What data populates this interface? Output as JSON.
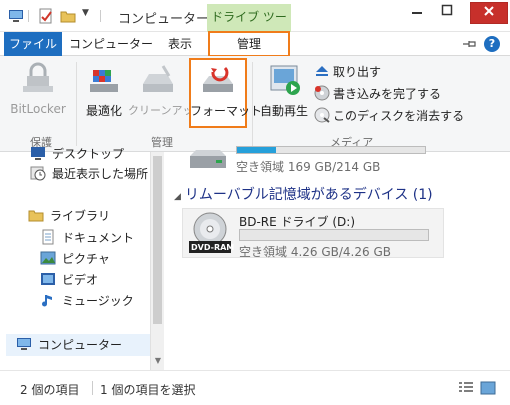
{
  "titlebar": {
    "title": "コンピューター",
    "context_tab": "ドライブ ツール"
  },
  "tabs": {
    "file": "ファイル",
    "computer": "コンピューター",
    "view": "表示",
    "manage": "管理"
  },
  "ribbon": {
    "bitlocker": "BitLocker",
    "optimize": "最適化",
    "cleanup": "クリーンアップ",
    "format": "フォーマット",
    "autoplay": "自動再生",
    "eject": "取り出す",
    "finish_burning": "書き込みを完了する",
    "erase_disc": "このディスクを消去する",
    "group_protect": "保護",
    "group_manage": "管理",
    "group_media": "メディア"
  },
  "nav": {
    "desktop": "デスクトップ",
    "recent": "最近表示した場所",
    "library": "ライブラリ",
    "documents": "ドキュメント",
    "pictures": "ピクチャ",
    "videos": "ビデオ",
    "music": "ミュージック",
    "computer": "コンピューター"
  },
  "content": {
    "hdd_free": "空き領域 169 GB/214 GB",
    "hdd_fill": 0.21,
    "removable_header": "リムーバブル記憶域があるデバイス (1)",
    "dvd_name": "BD-RE ドライブ (D:)",
    "dvd_free": "空き領域 4.26 GB/4.26 GB",
    "dvd_label": "DVD-RAM",
    "dvd_fill": 0.0
  },
  "status": {
    "items": "2 個の項目",
    "selected": "1 個の項目を選択"
  },
  "colors": {
    "accent": "#1e6ec0",
    "highlight": "#f07c1a",
    "context_tab": "#cfe8b8"
  }
}
